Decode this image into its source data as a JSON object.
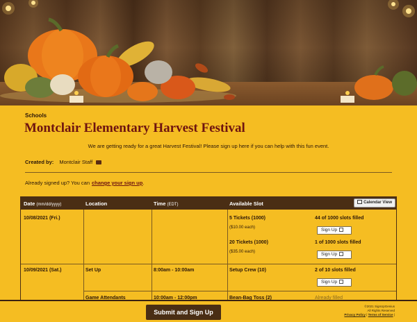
{
  "event": {
    "category": "Schools",
    "title": "Montclair Elementary Harvest Festival",
    "intro": "We are getting ready for a great Harvest Festival!  Please sign up here if you can help with this fun event.",
    "created_by_label": "Created by:",
    "created_by_name": "Montclair Staff",
    "already_prefix": "Already signed up? You can",
    "change_link": "change your sign up",
    "already_suffix": "."
  },
  "table": {
    "headers": {
      "date": "Date",
      "date_sub": "(mm/dd/yyyy)",
      "location": "Location",
      "time": "Time",
      "time_sub": "(EDT)",
      "slot": "Available Slot"
    },
    "calendar_view": "Calendar View",
    "rows": [
      {
        "date": "10/08/2021 (Fri.)",
        "slots": [
          {
            "name": "5 Tickets (1000)",
            "price": "($10.00 each)",
            "filled": "44 of 1000 slots filled",
            "button": "Sign Up"
          },
          {
            "name": "20 Tickets (1000)",
            "price": "($35.00 each)",
            "filled": "1 of 1000 slots filled",
            "button": "Sign Up"
          }
        ]
      },
      {
        "date": "10/09/2021 (Sat.)",
        "location": "Set Up",
        "time": "8:00am - 10:00am",
        "slots": [
          {
            "name": "Setup Crew (10)",
            "filled": "2 of 10 slots filled",
            "button": "Sign Up"
          }
        ]
      },
      {
        "location": "Game Attendants",
        "time": "10:00am - 12:00pm",
        "slots": [
          {
            "name": "Bean-Bag Toss (2)",
            "status": "Already filled"
          }
        ]
      }
    ]
  },
  "footer": {
    "submit": "Submit and Sign Up",
    "copyright": "©2021 SignUpGenius",
    "rights": "All Rights Reserved",
    "privacy": "Privacy Policy",
    "separator": "|",
    "terms": "Terms of Service"
  },
  "colors": {
    "background": "#f5bd22",
    "title": "#6e1410",
    "header_bar": "#4a2e14",
    "submit_button": "#4a2e14"
  }
}
